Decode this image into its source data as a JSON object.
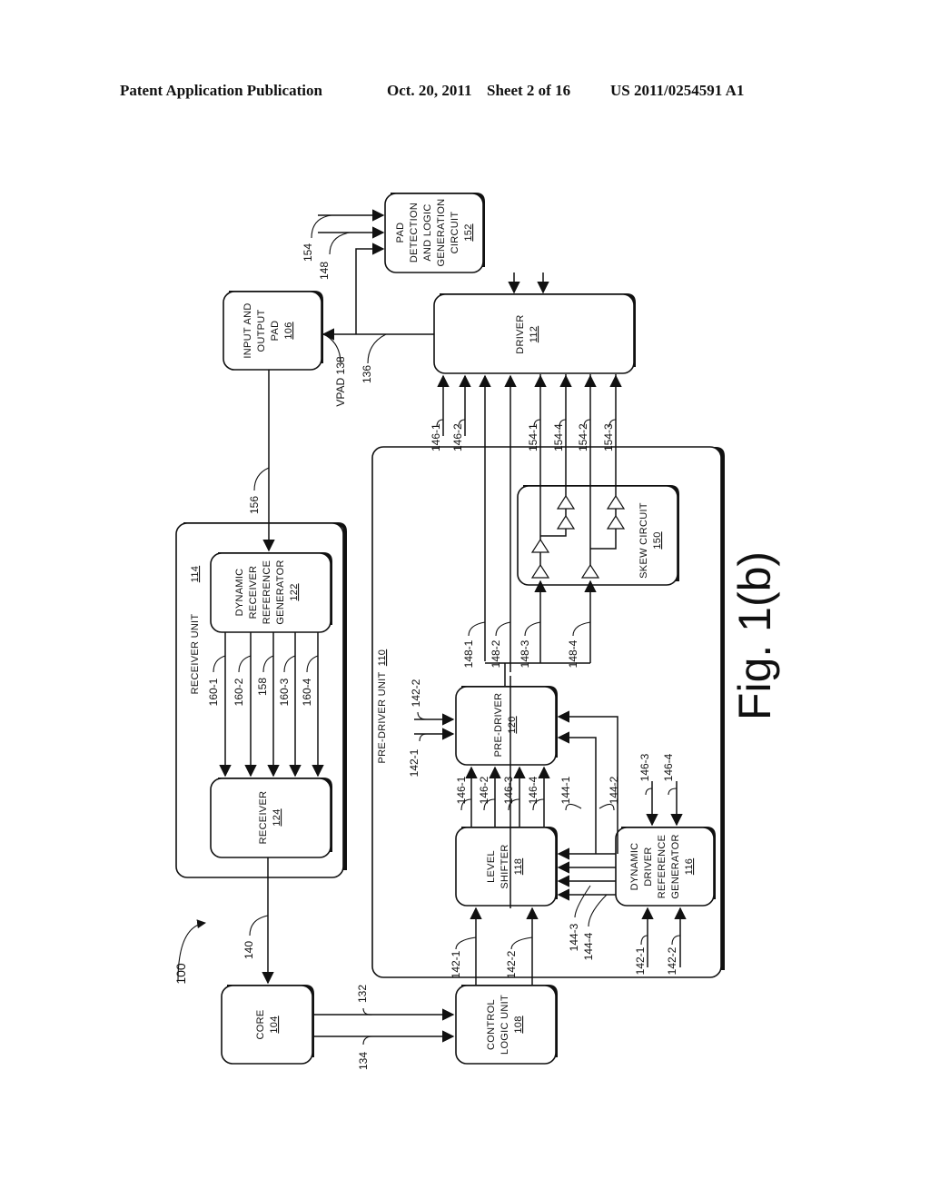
{
  "header": {
    "publication": "Patent Application Publication",
    "date": "Oct. 20, 2011",
    "sheet": "Sheet 2 of 16",
    "number": "US 2011/0254591 A1"
  },
  "figure": {
    "title": "Fig. 1(b)",
    "ref": "100",
    "orientation": "rotated 90 degrees counter-clockwise"
  },
  "blocks": {
    "io_pad": {
      "lines": [
        "INPUT AND",
        "OUTPUT",
        "PAD"
      ],
      "ref": "106"
    },
    "pad_detect": {
      "lines": [
        "PAD",
        "DETECTION",
        "AND LOGIC",
        "GENERATION",
        "CIRCUIT"
      ],
      "ref": "152"
    },
    "driver": {
      "lines": [
        "DRIVER"
      ],
      "ref": "112"
    },
    "receiver_unit": {
      "label": "RECEIVER UNIT",
      "ref": "114"
    },
    "dyn_recv_ref": {
      "lines": [
        "DYNAMIC",
        "RECEIVER",
        "REFERENCE",
        "GENERATOR"
      ],
      "ref": "122"
    },
    "receiver": {
      "lines": [
        "RECEIVER"
      ],
      "ref": "124"
    },
    "predriver_unit": {
      "label": "PRE-DRIVER UNIT",
      "ref": "110"
    },
    "skew": {
      "lines": [
        "SKEW CIRCUIT"
      ],
      "ref": "150"
    },
    "predriver": {
      "lines": [
        "PRE-DRIVER"
      ],
      "ref": "120"
    },
    "level_shifter": {
      "lines": [
        "LEVEL",
        "SHIFTER"
      ],
      "ref": "118"
    },
    "dyn_drv_ref": {
      "lines": [
        "DYNAMIC",
        "DRIVER",
        "REFERENCE",
        "GENERATOR"
      ],
      "ref": "116"
    },
    "core": {
      "lines": [
        "CORE"
      ],
      "ref": "104"
    },
    "control": {
      "lines": [
        "CONTROL",
        "LOGIC UNIT"
      ],
      "ref": "108"
    }
  },
  "signals": {
    "s154": "154",
    "s148": "148",
    "vpad138": "VPAD 138",
    "s136": "136",
    "s146_1": "146-1",
    "s146_2": "146-2",
    "s154_1": "154-1",
    "s154_4": "154-4",
    "s154_2": "154-2",
    "s154_3": "154-3",
    "s156": "156",
    "s160_1": "160-1",
    "s160_2": "160-2",
    "s158": "158",
    "s160_3": "160-3",
    "s160_4": "160-4",
    "s148_1": "148-1",
    "s148_2": "148-2",
    "s148_3": "148-3",
    "s148_4": "148-4",
    "s142_1_pd": "142-1",
    "s142_2_pd": "142-2",
    "s146_1_pd": "146-1",
    "s146_2_pd": "146-2",
    "s146_3_pd": "146-3",
    "s146_4_pd": "146-4",
    "s144_1": "144-1",
    "s144_2": "144-2",
    "s146_3_dd": "146-3",
    "s146_4_dd": "146-4",
    "s144_3": "144-3",
    "s144_4": "144-4",
    "s142_1_dd": "142-1",
    "s142_2_dd": "142-2",
    "s142_1_ls": "142-1",
    "s142_2_ls": "142-2",
    "s140": "140",
    "s132": "132",
    "s134": "134"
  }
}
